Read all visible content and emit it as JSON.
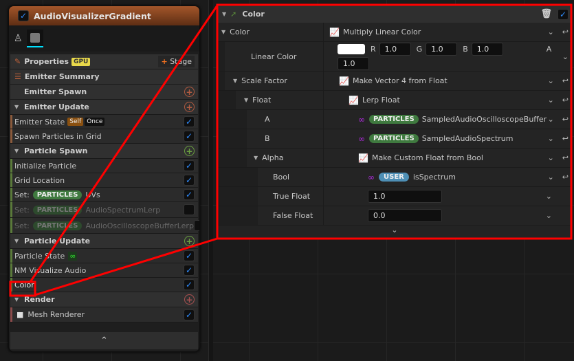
{
  "node": {
    "title": "AudioVisualizerGradient",
    "properties": "Properties",
    "gpu": "GPU",
    "stage": "Stage",
    "summary": "Emitter Summary",
    "sections": {
      "emitter_spawn": "Emitter Spawn",
      "emitter_update": "Emitter Update",
      "particle_spawn": "Particle Spawn",
      "particle_update": "Particle Update",
      "render": "Render"
    },
    "modules": {
      "emitter_state": "Emitter State",
      "self": "Self",
      "once": "Once",
      "spawn_grid": "Spawn Particles in Grid",
      "init": "Initialize Particle",
      "grid_loc": "Grid Location",
      "set": "Set:",
      "particles": "PARTICLES",
      "uvs": "UVs",
      "lerp": "AudioSpectrumLerp",
      "osc_lerp": "AudioOscilloscopeBufferLerp",
      "particle_state": "Particle State",
      "infinity": "∞",
      "nm": "NM Visualize Audio",
      "color": "Color",
      "mesh": "Mesh Renderer"
    }
  },
  "panel": {
    "title": "Color",
    "rows": {
      "color": "Color",
      "mlc": "Multiply Linear Color",
      "linear": "Linear Color",
      "r": "R",
      "g": "G",
      "b": "B",
      "a": "A",
      "rv": "1.0",
      "gv": "1.0",
      "bv": "1.0",
      "av": "1.0",
      "scale": "Scale Factor",
      "mv4": "Make Vector 4 from Float",
      "float": "Float",
      "lerp": "Lerp Float",
      "A": "A",
      "B": "B",
      "particles": "PARTICLES",
      "a_val": "SampledAudioOscilloscopeBuffer",
      "b_val": "SampledAudioSpectrum",
      "alpha": "Alpha",
      "mcf": "Make Custom Float from Bool",
      "bool": "Bool",
      "user": "USER",
      "bool_val": "isSpectrum",
      "true_f": "True Float",
      "true_v": "1.0",
      "false_f": "False Float",
      "false_v": "0.0"
    }
  },
  "colors": {
    "highlight": "#ff0000",
    "accent": "#2f8cff"
  }
}
